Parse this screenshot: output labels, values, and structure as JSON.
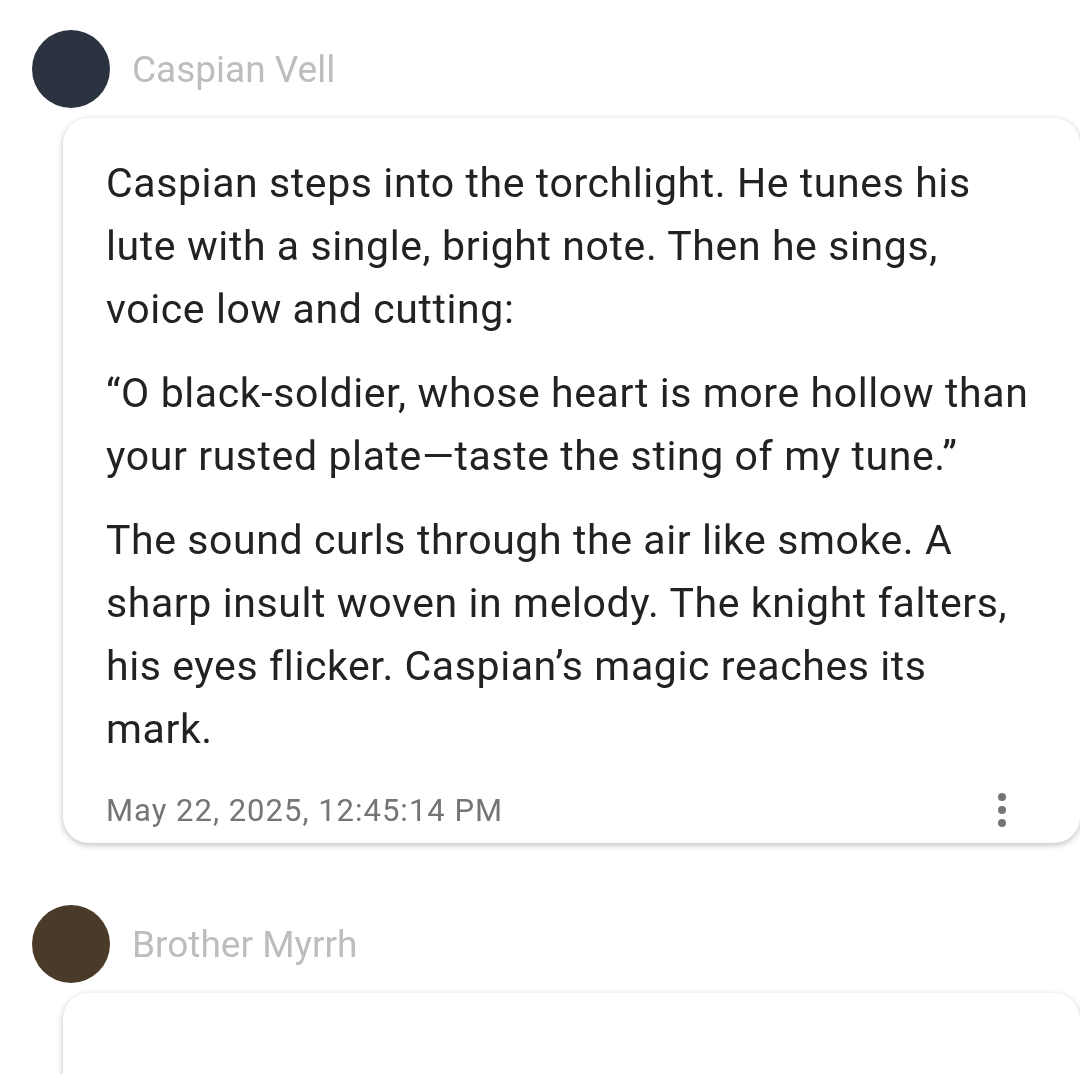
{
  "messages": [
    {
      "author": "Caspian Vell",
      "paragraphs": [
        "Caspian steps into the torchlight. He tunes his lute with a single, bright note. Then he sings, voice low and cutting:",
        "“O black-soldier, whose heart is more hollow than your rusted plate—taste the sting of my tune.”",
        "The sound curls through the air like smoke. A sharp insult woven in melody. The knight falters, his eyes flicker. Caspian’s magic reaches its mark."
      ],
      "timestamp": "May 22, 2025, 12:45:14 PM"
    },
    {
      "author": "Brother Myrrh"
    }
  ]
}
